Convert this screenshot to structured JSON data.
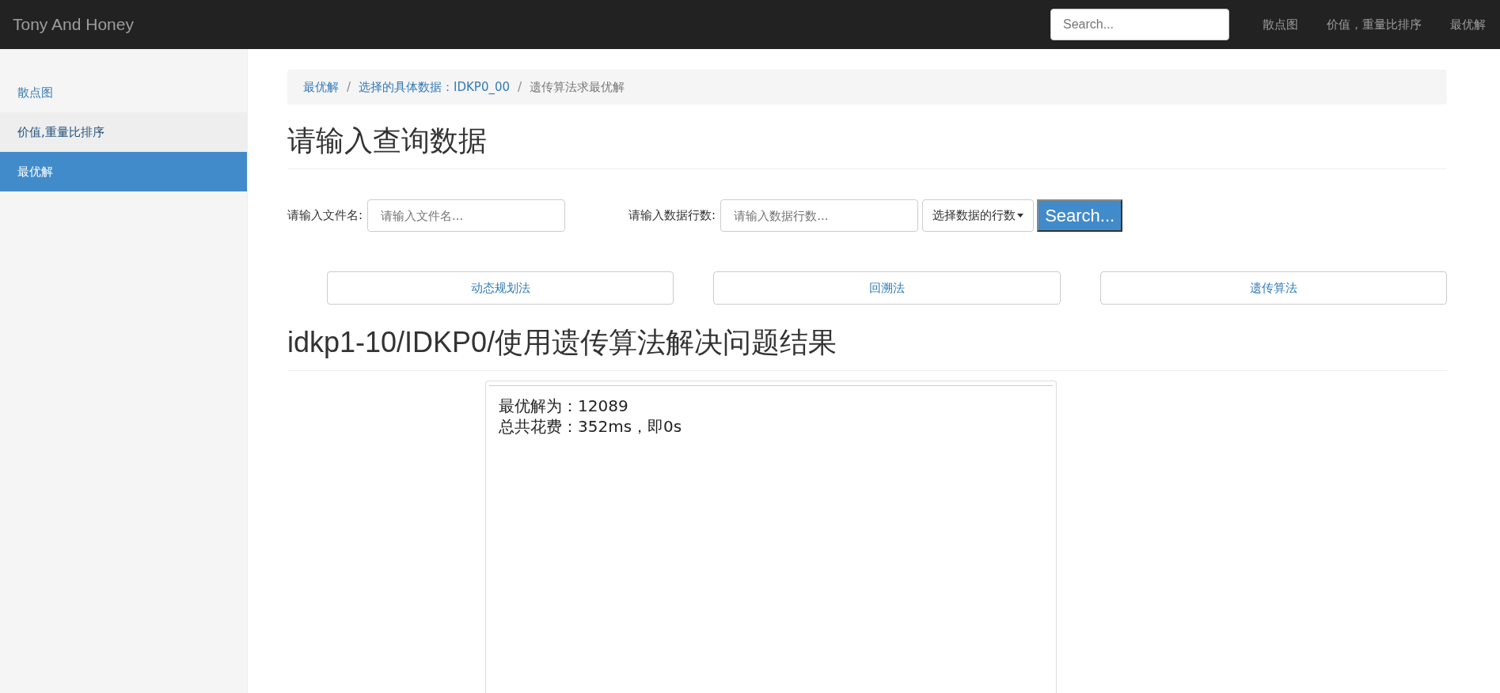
{
  "navbar": {
    "brand": "Tony And Honey",
    "search": {
      "placeholder": "Search..."
    },
    "links": [
      "散点图",
      "价值，重量比排序",
      "最优解"
    ]
  },
  "sidebar": {
    "items": [
      {
        "label": "散点图",
        "selected": false,
        "hovered": false
      },
      {
        "label": "价值,重量比排序",
        "selected": false,
        "hovered": true
      },
      {
        "label": "最优解",
        "selected": true,
        "hovered": false
      }
    ]
  },
  "breadcrumb": [
    {
      "kind": "link",
      "label": "最优解"
    },
    {
      "kind": "separator",
      "label": "/"
    },
    {
      "kind": "link",
      "label": "选择的具体数据：IDKP0_00"
    },
    {
      "kind": "separator",
      "label": "/"
    },
    {
      "kind": "current",
      "label": "遗传算法求最优解"
    }
  ],
  "query_heading": "请输入查询数据",
  "form": {
    "file_label": "请输入文件名:",
    "file_field": {
      "placeholder": "请输入文件名..."
    },
    "rows_label": "请输入数据行数:",
    "rows_field": {
      "placeholder": "请输入数据行数..."
    },
    "rows_dropdown": "选择数据的行数",
    "search_button": "Search..."
  },
  "algorithm_buttons": [
    "动态规划法",
    "回溯法",
    "遗传算法"
  ],
  "result_heading": "idkp1-10/IDKP0/使用遗传算法解决问题结果",
  "result_lines": [
    "最优解为：12089",
    "总共花费：352ms，即0s"
  ]
}
